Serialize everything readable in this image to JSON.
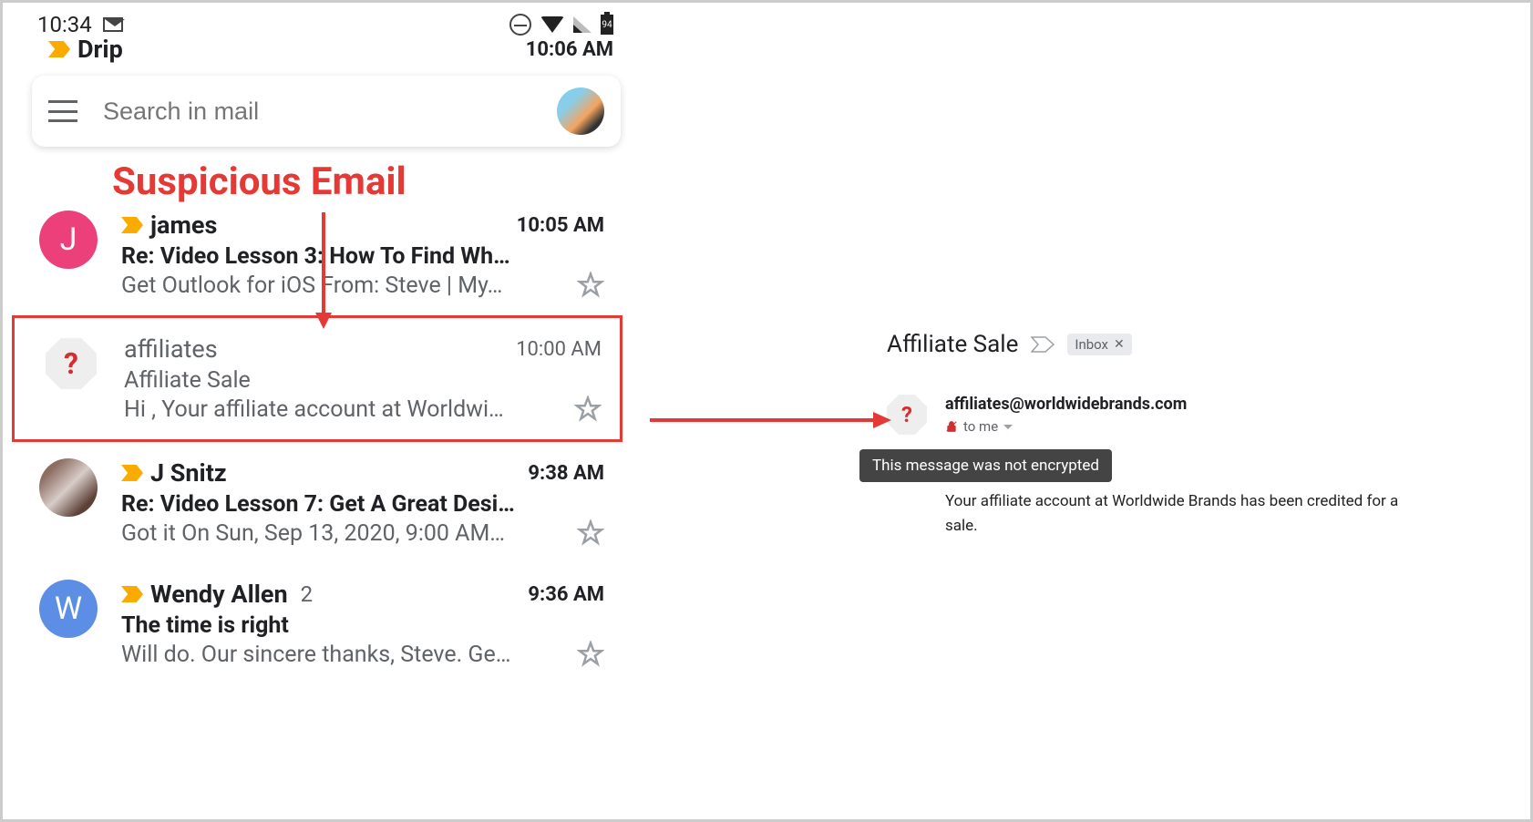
{
  "status_bar": {
    "time": "10:34",
    "battery": "94"
  },
  "partial_email": {
    "sender": "Drip",
    "time": "10:06 AM"
  },
  "search": {
    "placeholder": "Search in mail"
  },
  "annotation": {
    "title": "Suspicious Email"
  },
  "emails": [
    {
      "sender": "james",
      "time": "10:05 AM",
      "subject": "Re: Video Lesson 3: How To Find Wh…",
      "snippet": "Get Outlook for iOS From: Steve | My…",
      "avatar_letter": "J",
      "important": true,
      "unread": true,
      "avatar_class": "avatar-j"
    },
    {
      "sender": "affiliates",
      "time": "10:00 AM",
      "subject": "Affiliate Sale",
      "snippet": "Hi , Your affiliate account at Worldwi…",
      "avatar_letter": "?",
      "important": false,
      "unread": false,
      "suspicious": true,
      "highlighted": true
    },
    {
      "sender": "J Snitz",
      "time": "9:38 AM",
      "subject": "Re: Video Lesson 7: Get A Great Desi…",
      "snippet": "Got it On Sun, Sep 13, 2020, 9:00 AM…",
      "important": true,
      "unread": true,
      "avatar_class": "avatar-photo"
    },
    {
      "sender": "Wendy Allen",
      "time": "9:36 AM",
      "subject": "The time is right",
      "snippet": "Will do. Our sincere thanks, Steve. Ge…",
      "avatar_letter": "W",
      "thread_count": "2",
      "important": true,
      "unread": true,
      "avatar_class": "avatar-w"
    }
  ],
  "detail": {
    "subject": "Affiliate Sale",
    "inbox_label": "Inbox",
    "sender_email": "affiliates@worldwidebrands.com",
    "to_label": "to me",
    "encryption_tooltip": "This message was not encrypted",
    "body": "Your affiliate account  at Worldwide Brands has been credited for a sale."
  }
}
